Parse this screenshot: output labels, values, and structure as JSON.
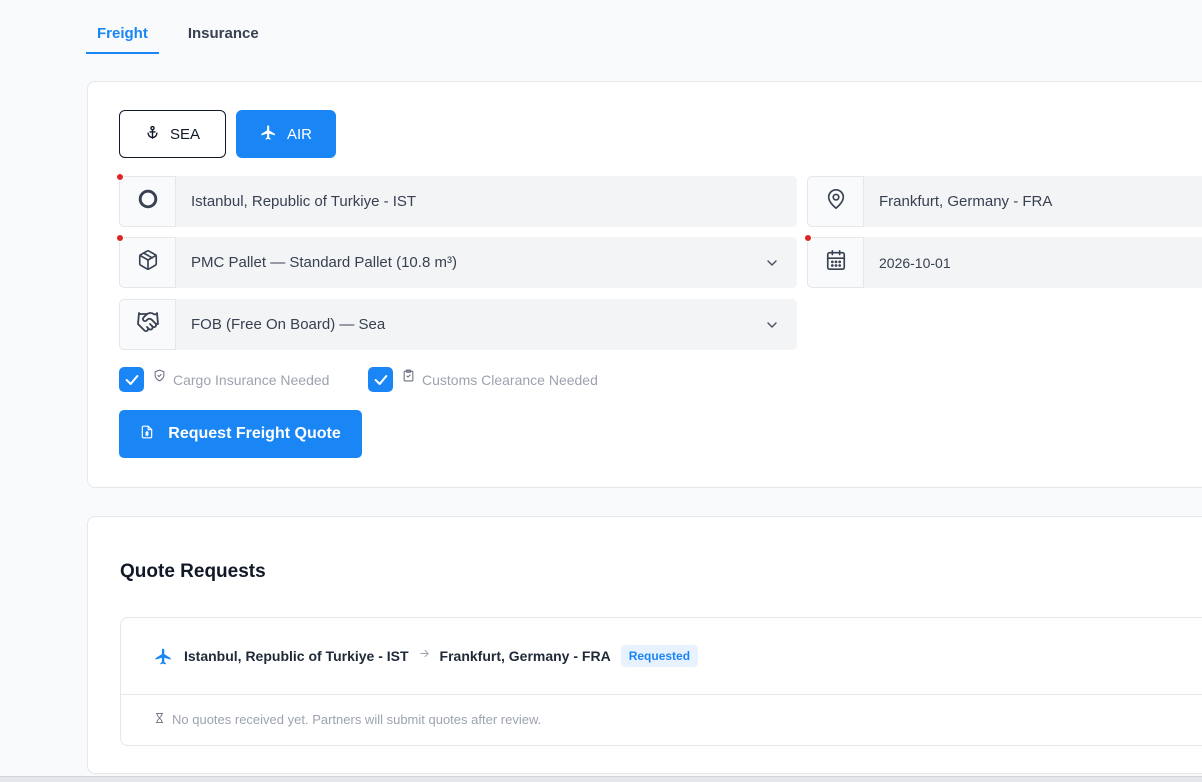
{
  "tabs": [
    {
      "label": "Freight",
      "active": true
    },
    {
      "label": "Insurance",
      "active": false
    }
  ],
  "mode": {
    "sea_label": "SEA",
    "air_label": "AIR",
    "selected": "AIR"
  },
  "form": {
    "origin": {
      "value": "Istanbul, Republic of Turkiye - IST",
      "icon": "circle-origin-icon",
      "required": true
    },
    "destination": {
      "value": "Frankfurt, Germany - FRA",
      "icon": "map-pin-icon"
    },
    "cargo": {
      "value": "PMC Pallet — Standard Pallet (10.8 m³)",
      "icon": "package-icon",
      "required": true
    },
    "date": {
      "value": "2026-10-01",
      "icon": "calendar-icon",
      "required": true
    },
    "incoterm": {
      "value": "FOB (Free On Board) — Sea",
      "icon": "handshake-icon"
    },
    "insurance_checkbox": {
      "label": "Cargo Insurance Needed",
      "checked": true,
      "icon": "shield-check-icon"
    },
    "customs_checkbox": {
      "label": "Customs Clearance Needed",
      "checked": true,
      "icon": "clipboard-check-icon"
    },
    "submit_label": "Request Freight Quote"
  },
  "quotes": {
    "title": "Quote Requests",
    "items": [
      {
        "mode_icon": "plane-icon",
        "origin": "Istanbul, Republic of Turkiye - IST",
        "destination": "Frankfurt, Germany - FRA",
        "status": "Requested",
        "empty_message": "No quotes received yet. Partners will submit quotes after review."
      }
    ]
  },
  "colors": {
    "accent": "#1a86f5",
    "required_dot": "#dc2626",
    "badge_bg": "#e8f1fe"
  }
}
